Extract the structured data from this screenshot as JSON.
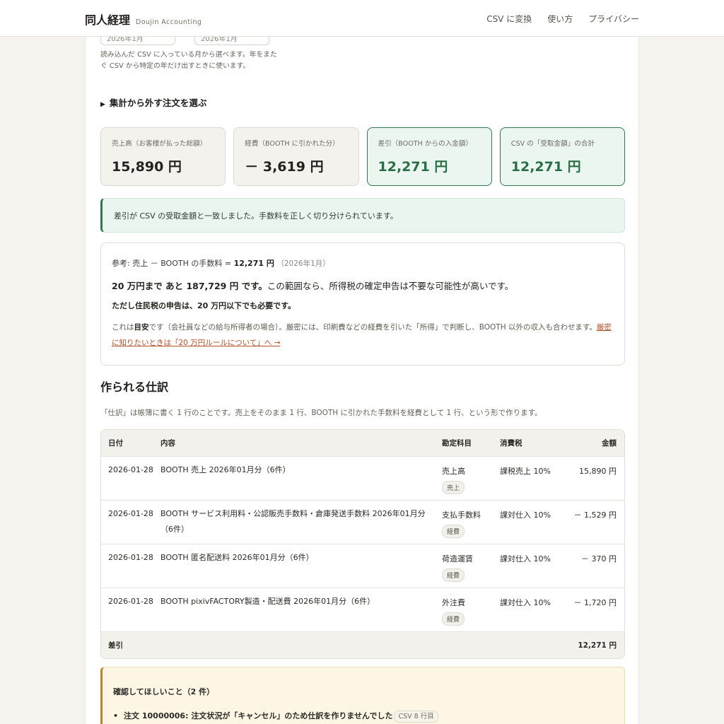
{
  "header": {
    "title": "同人経理",
    "subtitle": "Doujin Accounting",
    "nav": [
      "CSV に変換",
      "使い方",
      "プライバシー"
    ]
  },
  "filters": {
    "from_value": "2026年1月",
    "to_value": "2026年1月",
    "help": "読み込んだ CSV に入っている月から選べます。年をまたぐ CSV から特定の年だけ出すときに使います。"
  },
  "exclude_toggle": "集計から外す注文を選ぶ",
  "summary": [
    {
      "label": "売上高（お客様が払った総額）",
      "value": "15,890 円"
    },
    {
      "label": "経費（BOOTH に引かれた分）",
      "value": "－ 3,619 円"
    },
    {
      "label": "差引（BOOTH からの入金額）",
      "value": "12,271 円"
    },
    {
      "label": "CSV の「受取金額」の合計",
      "value": "12,271 円"
    }
  ],
  "match_notice": "差引が CSV の受取金額と一致しました。手数料を正しく切り分けられています。",
  "reference": {
    "formula_prefix": "参考: 売上 － BOOTH の手数料 = ",
    "formula_value": "12,271 円",
    "period": "（2026年1月）",
    "remain_bold": "20 万円まで あと 187,729 円 です。",
    "remain_rest": "この範囲なら、所得税の確定申告は不要な可能性が高いです。",
    "resident_tax": "ただし住民税の申告は、20 万円以下でも必要です。",
    "note_prefix": "これは",
    "note_bold": "目安",
    "note_rest": "です（会社員などの給与所得者の場合）。厳密には、印刷費などの経費を引いた「所得」で判断し、BOOTH 以外の収入も合わせます。",
    "note_link": "厳密に知りたいときは「20 万円ルールについて」へ →"
  },
  "journal": {
    "title": "作られる仕訳",
    "description": "「仕訳」は帳簿に書く 1 行のことです。売上をそのまま 1 行、BOOTH に引かれた手数料を経費として 1 行、という形で作ります。",
    "headers": {
      "date": "日付",
      "desc": "内容",
      "account": "勘定科目",
      "tax": "消費税",
      "amount": "金額"
    },
    "rows": [
      {
        "date": "2026-01-28",
        "desc": "BOOTH 売上 2026年01月分（6件）",
        "account": "売上高",
        "badge": "売上",
        "tax": "課税売上 10%",
        "amount": "15,890 円"
      },
      {
        "date": "2026-01-28",
        "desc": "BOOTH サービス利用料・公認販売手数料・倉庫発送手数料 2026年01月分（6件）",
        "account": "支払手数料",
        "badge": "経費",
        "tax": "課対仕入 10%",
        "amount": "－ 1,529 円"
      },
      {
        "date": "2026-01-28",
        "desc": "BOOTH 匿名配送料 2026年01月分（6件）",
        "account": "荷造運賃",
        "badge": "経費",
        "tax": "課対仕入 10%",
        "amount": "－ 370 円"
      },
      {
        "date": "2026-01-28",
        "desc": "BOOTH pixivFACTORY製造・配送費 2026年01月分（6件）",
        "account": "外注費",
        "badge": "経費",
        "tax": "課対仕入 10%",
        "amount": "－ 1,720 円"
      }
    ],
    "footer": {
      "label": "差引",
      "amount": "12,271 円"
    }
  },
  "check": {
    "title": "確認してほしいこと（2 件）",
    "items": [
      {
        "text": "注文 10000006: 注文状況が「キャンセル」のため仕訳を作りませんでした",
        "tag": "CSV 8 行目"
      }
    ]
  }
}
